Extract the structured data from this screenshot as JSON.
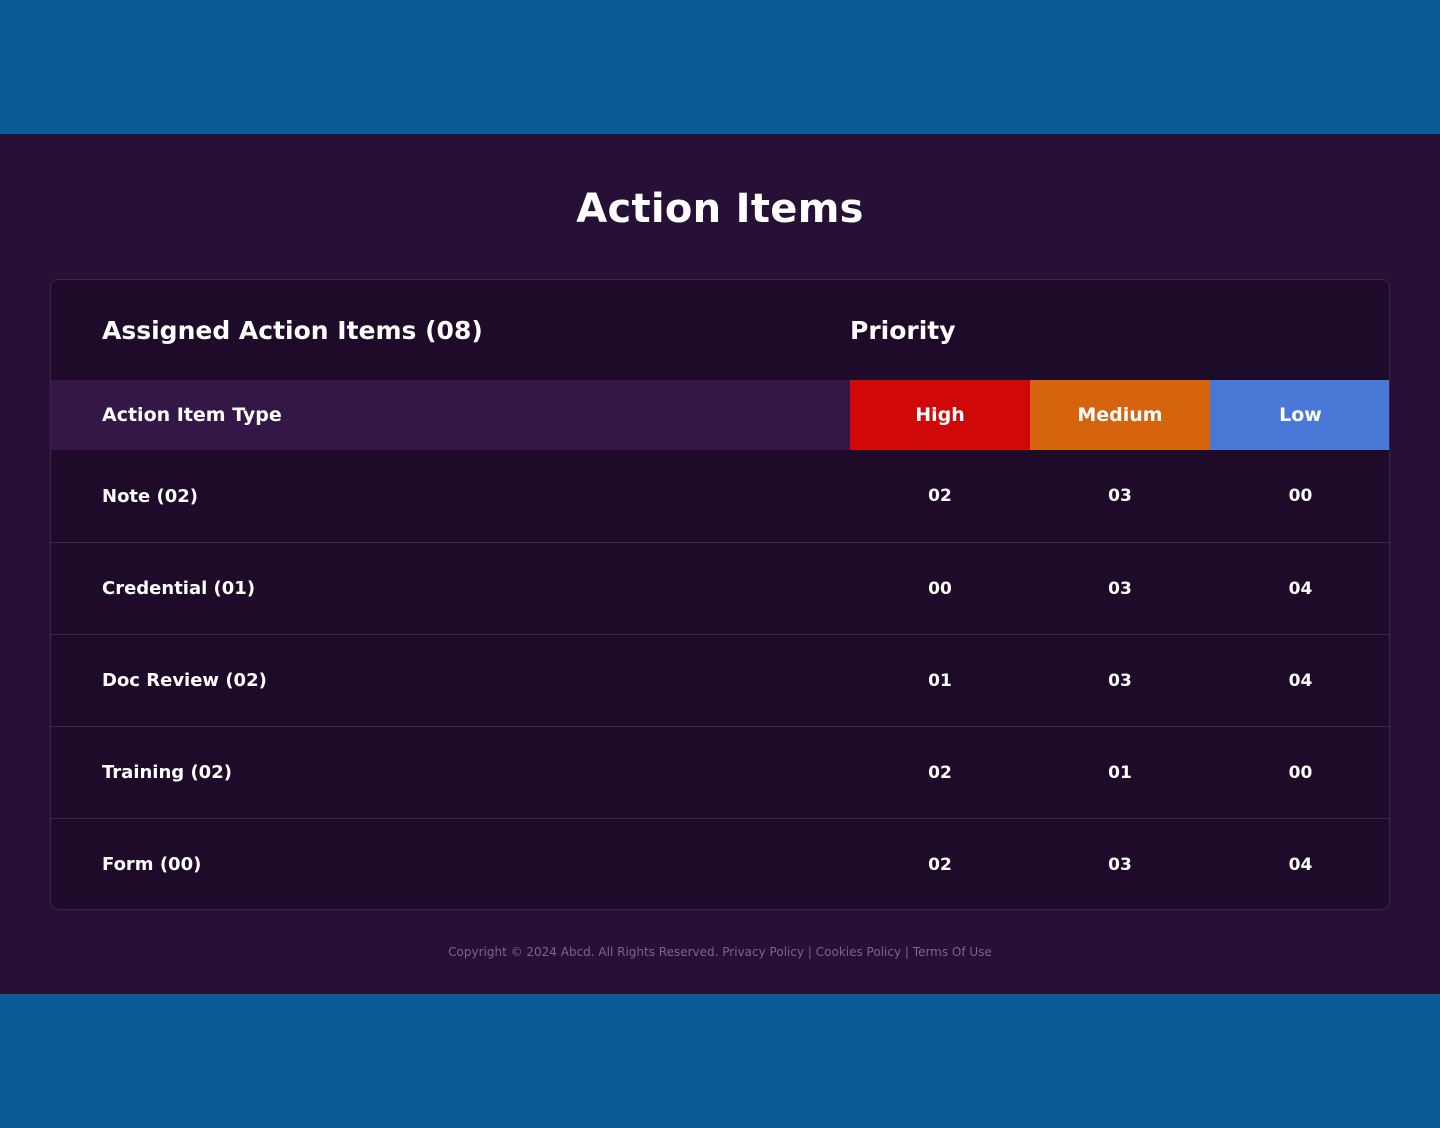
{
  "page": {
    "title": "Action Items"
  },
  "card": {
    "title": "Assigned Action Items (08)",
    "priority_title": "Priority"
  },
  "columns": {
    "type_header": "Action Item Type",
    "priorities": [
      {
        "label": "High",
        "color": "#d10808"
      },
      {
        "label": "Medium",
        "color": "#d6640e"
      },
      {
        "label": "Low",
        "color": "#4a78d6"
      }
    ]
  },
  "rows": [
    {
      "type": "Note (02)",
      "high": "02",
      "medium": "03",
      "low": "00"
    },
    {
      "type": "Credential (01)",
      "high": "00",
      "medium": "03",
      "low": "04"
    },
    {
      "type": "Doc Review (02)",
      "high": "01",
      "medium": "03",
      "low": "04"
    },
    {
      "type": "Training (02)",
      "high": "02",
      "medium": "01",
      "low": "00"
    },
    {
      "type": "Form (00)",
      "high": "02",
      "medium": "03",
      "low": "04"
    }
  ],
  "footer": {
    "copyright": "Copyright © 2024 Abcd. All Rights Reserved.",
    "privacy": "Privacy Policy",
    "sep1": "|",
    "cookies": "Cookies Policy",
    "sep2": "|",
    "terms": "Terms Of Use"
  }
}
